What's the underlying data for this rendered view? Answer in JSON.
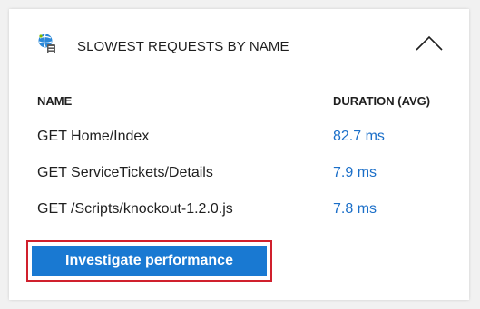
{
  "card": {
    "title": "SLOWEST REQUESTS BY NAME",
    "header_icon": "app-insights-globe-icon",
    "collapse_icon": "chevron-up-icon"
  },
  "table": {
    "columns": [
      "NAME",
      "DURATION (AVG)"
    ],
    "rows": [
      {
        "name": "GET Home/Index",
        "duration": "82.7 ms"
      },
      {
        "name": "GET ServiceTickets/Details",
        "duration": "7.9 ms"
      },
      {
        "name": "GET /Scripts/knockout-1.2.0.js",
        "duration": "7.8 ms"
      }
    ]
  },
  "actions": {
    "investigate_label": "Investigate performance"
  },
  "colors": {
    "accent": "#1979d2",
    "link": "#1a6ec8",
    "highlight": "#d0202d"
  }
}
